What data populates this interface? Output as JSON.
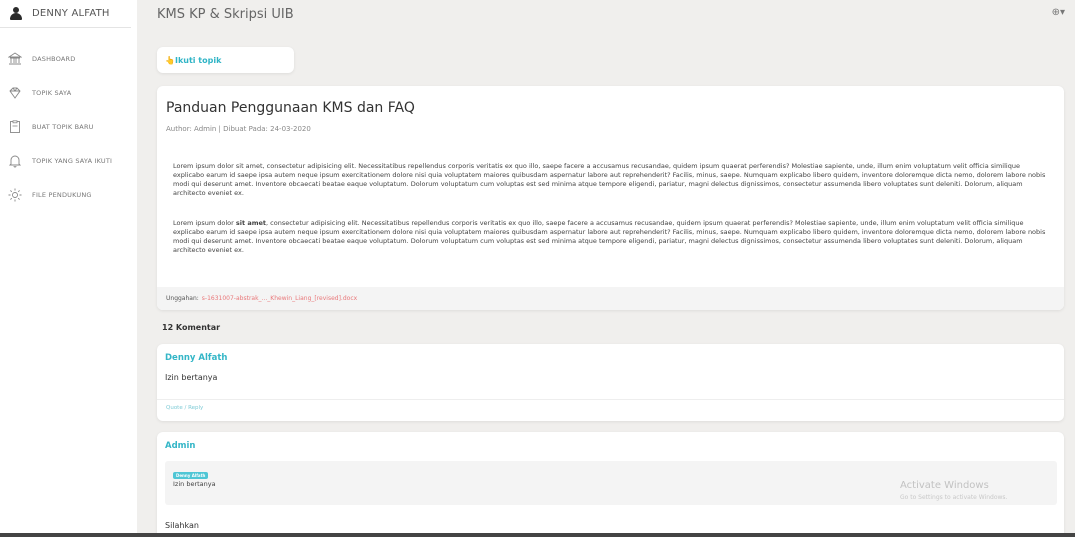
{
  "sidebar": {
    "user_name": "DENNY ALFATH",
    "user_icon": "user-icon",
    "items": [
      {
        "label": "DASHBOARD",
        "icon": "bank-icon"
      },
      {
        "label": "TOPIK SAYA",
        "icon": "diamond-icon"
      },
      {
        "label": "BUAT TOPIK BARU",
        "icon": "clipboard-icon"
      },
      {
        "label": "TOPIK YANG SAYA IKUTI",
        "icon": "bell-icon"
      },
      {
        "label": "FILE PENDUKUNG",
        "icon": "sun-icon"
      }
    ]
  },
  "header": {
    "title": "KMS KP & Skripsi UIB",
    "right_icon": "globe-icon",
    "right_glyph": "⊕▾"
  },
  "follow": {
    "label": "👆Ikuti topik"
  },
  "post": {
    "title": "Panduan Penggunaan KMS dan FAQ",
    "meta": "Author: Admin | Dibuat Pada: 24-03-2020",
    "paragraph1": "Lorem ipsum dolor sit amet, consectetur adipisicing elit. Necessitatibus repellendus corporis veritatis ex quo illo, saepe facere a accusamus recusandae, quidem ipsum quaerat perferendis? Molestiae sapiente, unde, illum enim voluptatum velit officia similique explicabo earum id saepe ipsa autem neque ipsum exercitationem dolore nisi quia voluptatem maiores quibusdam aspernatur labore aut reprehenderit? Facilis, minus, saepe. Numquam explicabo libero quidem, inventore doloremque dicta nemo, dolorem labore nobis modi qui deserunt amet. Inventore obcaecati beatae eaque voluptatum. Dolorum voluptatum cum voluptas est sed minima atque tempore eligendi, pariatur, magni delectus dignissimos, consectetur assumenda libero voluptates sunt deleniti. Dolorum, aliquam architecto eveniet ex.",
    "paragraph2_pre": "Lorem ipsum dolor ",
    "paragraph2_bold": "sit amet",
    "paragraph2_post": ", consectetur adipisicing elit. Necessitatibus repellendus corporis veritatis ex quo illo, saepe facere a accusamus recusandae, quidem ipsum quaerat perferendis? Molestiae sapiente, unde, illum enim voluptatum velit officia similique explicabo earum id saepe ipsa autem neque ipsum exercitationem dolore nisi quia voluptatem maiores quibusdam aspernatur labore aut reprehenderit? Facilis, minus, saepe. Numquam explicabo libero quidem, inventore doloremque dicta nemo, dolorem labore nobis modi qui deserunt amet. Inventore obcaecati beatae eaque voluptatum. Dolorum voluptatum cum voluptas est sed minima atque tempore eligendi, pariatur, magni delectus dignissimos, consectetur assumenda libero voluptates sunt deleniti. Dolorum, aliquam architecto eveniet ex.",
    "upload_label": "Unggahan:",
    "upload_file": "s-1631007-abstrak_..._Khewin_Liang_[revised].docx"
  },
  "comments": {
    "count_label": "12 Komentar",
    "items": [
      {
        "author": "Denny Alfath",
        "text": "Izin bertanya",
        "reply_label": "Quote / Reply"
      },
      {
        "author": "Admin",
        "quote_badge": "Denny Alfath",
        "quote_text": "Izin bertanya",
        "text": "Silahkan"
      }
    ]
  },
  "watermark": {
    "line1": "Activate Windows",
    "line2": "Go to Settings to activate Windows."
  },
  "colors": {
    "accent": "#34b6c7",
    "file_link": "#e9787a",
    "background": "#f0efed"
  }
}
